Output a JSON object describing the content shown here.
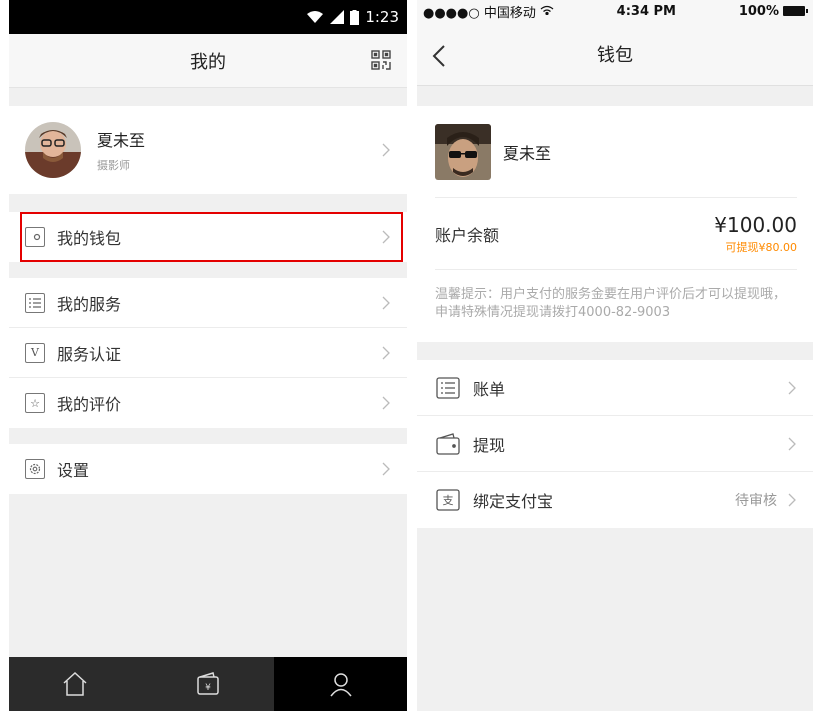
{
  "left": {
    "status_time": "1:23",
    "header_title": "我的",
    "profile": {
      "name": "夏未至",
      "role": "摄影师"
    },
    "wallet_label": "我的钱包",
    "menu": [
      {
        "label": "我的服务",
        "icon": "list-icon"
      },
      {
        "label": "服务认证",
        "icon": "v-badge-icon"
      },
      {
        "label": "我的评价",
        "icon": "star-icon"
      }
    ],
    "settings_label": "设置",
    "tabs": [
      "home-icon",
      "wallet-tab-icon",
      "profile-tab-icon"
    ]
  },
  "right": {
    "carrier": "●●●●○ 中国移动",
    "time": "4:34 PM",
    "battery": "100%",
    "title": "钱包",
    "profile_name": "夏未至",
    "balance_label": "账户余额",
    "balance_amount": "¥100.00",
    "withdrawable": "可提现¥80.00",
    "tip": "温馨提示：用户支付的服务金要在用户评价后才可以提现哦，申请特殊情况提现请拨打4000-82-9003",
    "menu": [
      {
        "label": "账单",
        "icon": "bill-icon",
        "status": ""
      },
      {
        "label": "提现",
        "icon": "withdraw-wallet-icon",
        "status": ""
      },
      {
        "label": "绑定支付宝",
        "icon": "alipay-icon",
        "status": "待审核"
      }
    ]
  },
  "colors": {
    "highlight": "#e40000",
    "accent_orange": "#ff8a00",
    "tabbar": "#2b2b2b"
  }
}
